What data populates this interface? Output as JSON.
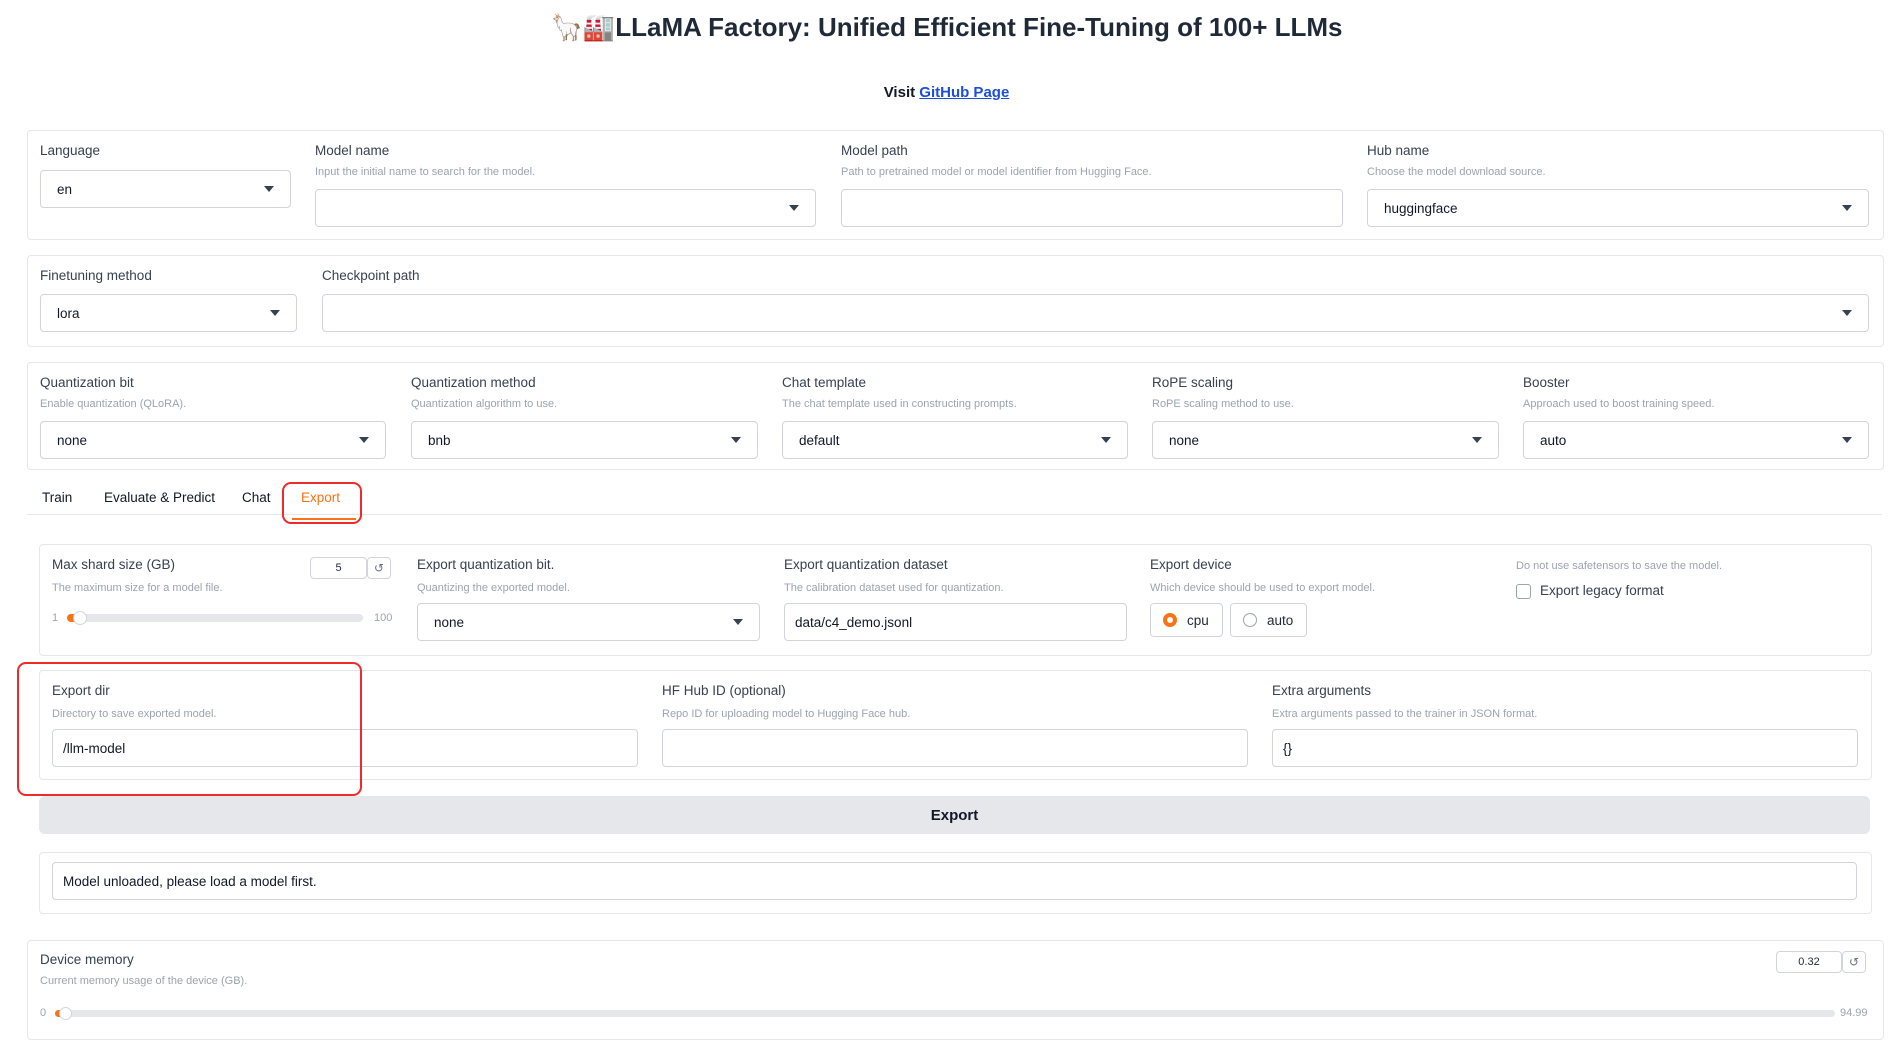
{
  "header": {
    "title_emoji": "🦙🏭",
    "title": "LLaMA Factory: Unified Efficient Fine-Tuning of 100+ LLMs",
    "visit_prefix": "Visit ",
    "github_link": "GitHub Page"
  },
  "top": {
    "language": {
      "label": "Language",
      "value": "en"
    },
    "model_name": {
      "label": "Model name",
      "info": "Input the initial name to search for the model.",
      "value": ""
    },
    "model_path": {
      "label": "Model path",
      "info": "Path to pretrained model or model identifier from Hugging Face.",
      "value": ""
    },
    "hub_name": {
      "label": "Hub name",
      "info": "Choose the model download source.",
      "value": "huggingface"
    }
  },
  "finetune": {
    "method": {
      "label": "Finetuning method",
      "value": "lora"
    },
    "checkpoint": {
      "label": "Checkpoint path",
      "value": ""
    }
  },
  "advanced": {
    "quant_bit": {
      "label": "Quantization bit",
      "info": "Enable quantization (QLoRA).",
      "value": "none"
    },
    "quant_method": {
      "label": "Quantization method",
      "info": "Quantization algorithm to use.",
      "value": "bnb"
    },
    "template": {
      "label": "Chat template",
      "info": "The chat template used in constructing prompts.",
      "value": "default"
    },
    "rope": {
      "label": "RoPE scaling",
      "info": "RoPE scaling method to use.",
      "value": "none"
    },
    "booster": {
      "label": "Booster",
      "info": "Approach used to boost training speed.",
      "value": "auto"
    }
  },
  "tabs": [
    {
      "label": "Train"
    },
    {
      "label": "Evaluate & Predict"
    },
    {
      "label": "Chat"
    },
    {
      "label": "Export"
    }
  ],
  "export": {
    "shard": {
      "label": "Max shard size (GB)",
      "info": "The maximum size for a model file.",
      "value": "5",
      "min": "1",
      "max": "100",
      "fraction": 0.04
    },
    "quant_bit": {
      "label": "Export quantization bit.",
      "info": "Quantizing the exported model.",
      "value": "none"
    },
    "quant_dataset": {
      "label": "Export quantization dataset",
      "info": "The calibration dataset used for quantization.",
      "value": "data/c4_demo.jsonl"
    },
    "device": {
      "label": "Export device",
      "info": "Which device should be used to export model.",
      "options": [
        "cpu",
        "auto"
      ],
      "selected": "cpu"
    },
    "legacy": {
      "info": "Do not use safetensors to save the model.",
      "label": "Export legacy format",
      "checked": false
    },
    "dir": {
      "label": "Export dir",
      "info": "Directory to save exported model.",
      "value": "/llm-model"
    },
    "hub_id": {
      "label": "HF Hub ID (optional)",
      "info": "Repo ID for uploading model to Hugging Face hub.",
      "value": ""
    },
    "extra": {
      "label": "Extra arguments",
      "info": "Extra arguments passed to the trainer in JSON format.",
      "value": "{}"
    },
    "button": "Export",
    "output": "Model unloaded, please load a model first."
  },
  "memory": {
    "label": "Device memory",
    "info": "Current memory usage of the device (GB).",
    "value": "0.32",
    "min": "0",
    "max": "94.99",
    "fraction": 0.0034
  },
  "colors": {
    "accent": "#f97316",
    "highlight": "#ef2a2a",
    "link": "#1d4ed8"
  }
}
